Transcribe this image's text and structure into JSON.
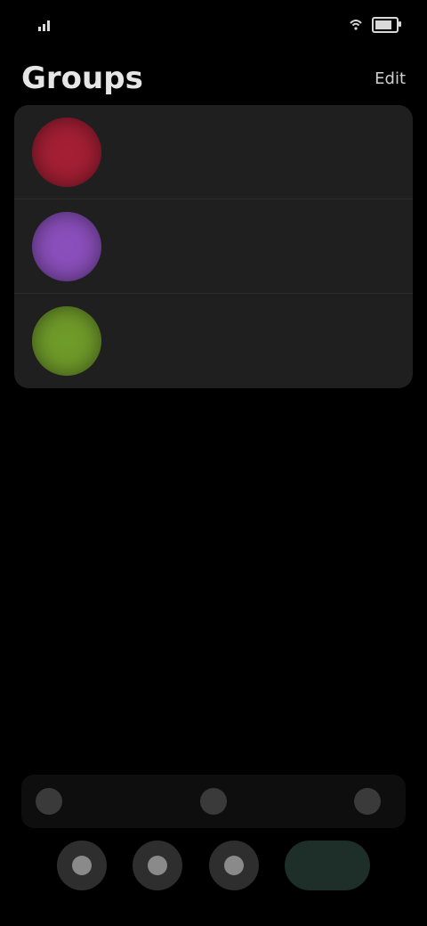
{
  "status_bar": {
    "time": "",
    "signal_label": "",
    "battery_icon": "battery-icon"
  },
  "header": {
    "title": "Groups",
    "action_label": "Edit"
  },
  "groups": [
    {
      "name": "",
      "color": "#a41f34"
    },
    {
      "name": "",
      "color": "#8b4fbc"
    },
    {
      "name": "",
      "color": "#6f9b2a"
    }
  ],
  "toolbar": {
    "left_label": "",
    "right_label": ""
  },
  "dock": {
    "buttons": [
      {
        "icon": "home-icon"
      },
      {
        "icon": "search-icon"
      },
      {
        "icon": "profile-icon"
      }
    ],
    "primary_label": ""
  },
  "colors": {
    "background": "#000000",
    "card": "#1f1f1f"
  }
}
